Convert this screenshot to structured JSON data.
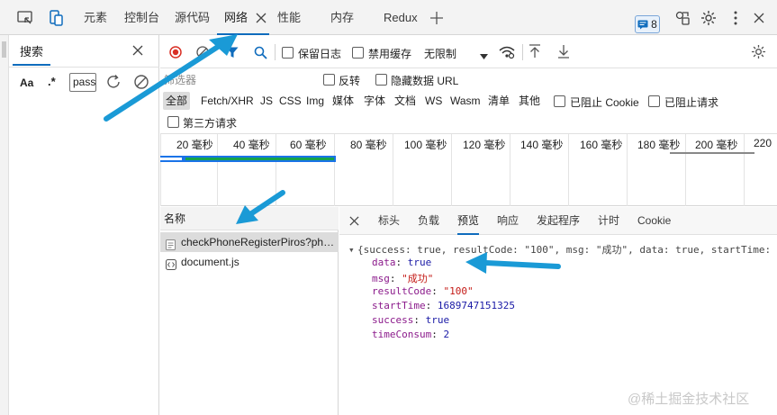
{
  "topbar": {
    "tabs": [
      {
        "label": "元素"
      },
      {
        "label": "控制台"
      },
      {
        "label": "源代码"
      },
      {
        "label": "网络"
      },
      {
        "label": "性能"
      },
      {
        "label": "内存"
      },
      {
        "label": "Redux"
      }
    ],
    "issue_count": "8",
    "icons": [
      "inspect-icon",
      "device-toggle-icon",
      "close-tab-icon",
      "add-tab-icon",
      "issues-icon",
      "share-icon",
      "gear-icon",
      "more-icon",
      "close-icon"
    ],
    "accent_color": "#0f6cbd"
  },
  "search_panel": {
    "tab_label": "搜索",
    "case_label": "Aa",
    "regex_label": ".*",
    "query": "pass"
  },
  "network_toolbar": {
    "preserve_log": "保留日志",
    "disable_cache": "禁用缓存",
    "throttle": "无限制"
  },
  "filters": {
    "placeholder": "筛选器",
    "invert": "反转",
    "hide_data_urls": "隐藏数据 URL",
    "types": [
      "全部",
      "Fetch/XHR",
      "JS",
      "CSS",
      "Img",
      "媒体",
      "字体",
      "文档",
      "WS",
      "Wasm",
      "清单",
      "其他"
    ],
    "blocked_cookies": "已阻止 Cookie",
    "blocked_requests": "已阻止请求",
    "third_party": "第三方请求"
  },
  "timeline": {
    "ticks": [
      "20 毫秒",
      "40 毫秒",
      "60 毫秒",
      "80 毫秒",
      "100 毫秒",
      "120 毫秒",
      "140 毫秒",
      "160 毫秒",
      "180 毫秒",
      "200 毫秒",
      "220"
    ]
  },
  "request_list": {
    "header": "名称",
    "rows": [
      {
        "name": "checkPhoneRegisterPiros?phone="
      },
      {
        "name": "document.js"
      }
    ]
  },
  "detail": {
    "tabs": [
      "标头",
      "负载",
      "预览",
      "响应",
      "发起程序",
      "计时",
      "Cookie"
    ],
    "active_tab": "预览",
    "summary": "{success: true, resultCode: \"100\", msg: \"成功\", data: true, startTime:",
    "fields": [
      {
        "key": "data",
        "value": "true"
      },
      {
        "key": "msg",
        "value": "\"成功\""
      },
      {
        "key": "resultCode",
        "value": "\"100\""
      },
      {
        "key": "startTime",
        "value": "1689747151325"
      },
      {
        "key": "success",
        "value": "true"
      },
      {
        "key": "timeConsum",
        "value": "2"
      }
    ]
  },
  "watermark": "@稀土掘金技术社区"
}
